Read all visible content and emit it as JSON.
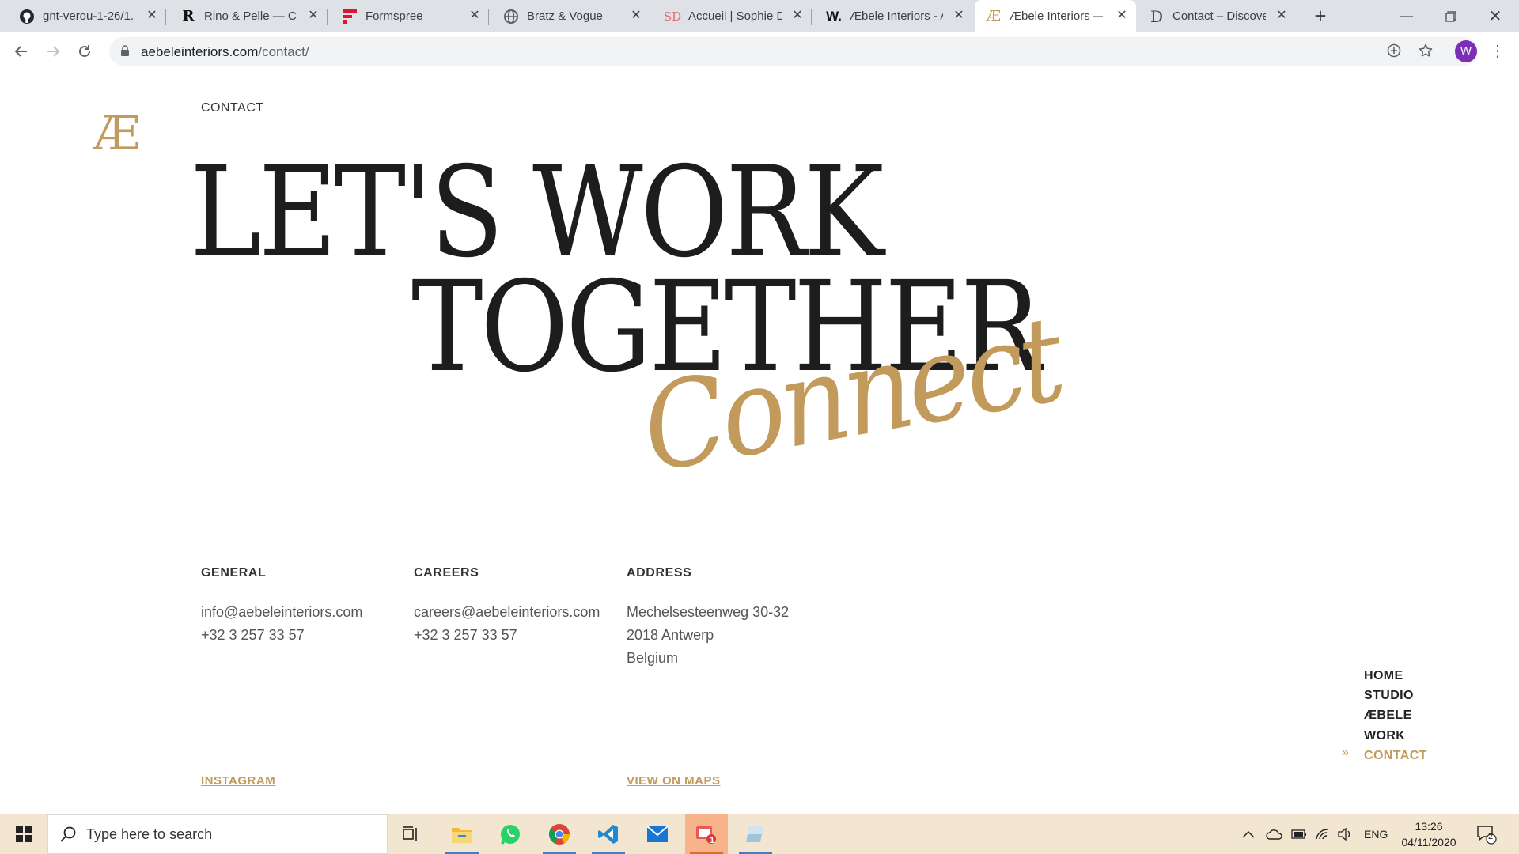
{
  "browser": {
    "tabs": [
      {
        "title": "gnt-verou-1-26/1.",
        "icon": "github-icon"
      },
      {
        "title": "Rino & Pelle — Co",
        "icon": "rino-r-icon"
      },
      {
        "title": "Formspree",
        "icon": "formspree-icon"
      },
      {
        "title": "Bratz & Vogue",
        "icon": "globe-icon"
      },
      {
        "title": "Accueil | Sophie D",
        "icon": "sd-icon"
      },
      {
        "title": "Æbele Interiors - A",
        "icon": "w-icon"
      },
      {
        "title": "Æbele Interiors —",
        "icon": "ae-icon"
      },
      {
        "title": "Contact – Discover",
        "icon": "d-icon"
      }
    ],
    "active_tab": 6,
    "url_host": "aebeleinteriors.com",
    "url_path": "/contact/",
    "profile_initial": "W"
  },
  "page": {
    "logo": "Æ",
    "breadcrumb": "CONTACT",
    "hero_line1": "LET'S WORK",
    "hero_line2": "TOGETHER",
    "script_word": "Connect",
    "general": {
      "heading": "GENERAL",
      "email": "info@aebeleinteriors.com",
      "phone": "+32 3 257 33 57",
      "link": "INSTAGRAM"
    },
    "careers": {
      "heading": "CAREERS",
      "email": "careers@aebeleinteriors.com",
      "phone": "+32 3 257 33 57"
    },
    "address": {
      "heading": "ADDRESS",
      "street": "Mechelsesteenweg 30-32",
      "city": "2018 Antwerp",
      "country": "Belgium",
      "link": "VIEW ON MAPS"
    },
    "nav": [
      "HOME",
      "STUDIO",
      "ÆBELE",
      "WORK",
      "CONTACT"
    ],
    "nav_arrow": "»",
    "accent_color": "#c29a5b"
  },
  "taskbar": {
    "search_placeholder": "Type here to search",
    "language": "ENG",
    "time": "13:26",
    "date": "04/11/2020",
    "notification_count": "2",
    "mail_badge": "1"
  }
}
